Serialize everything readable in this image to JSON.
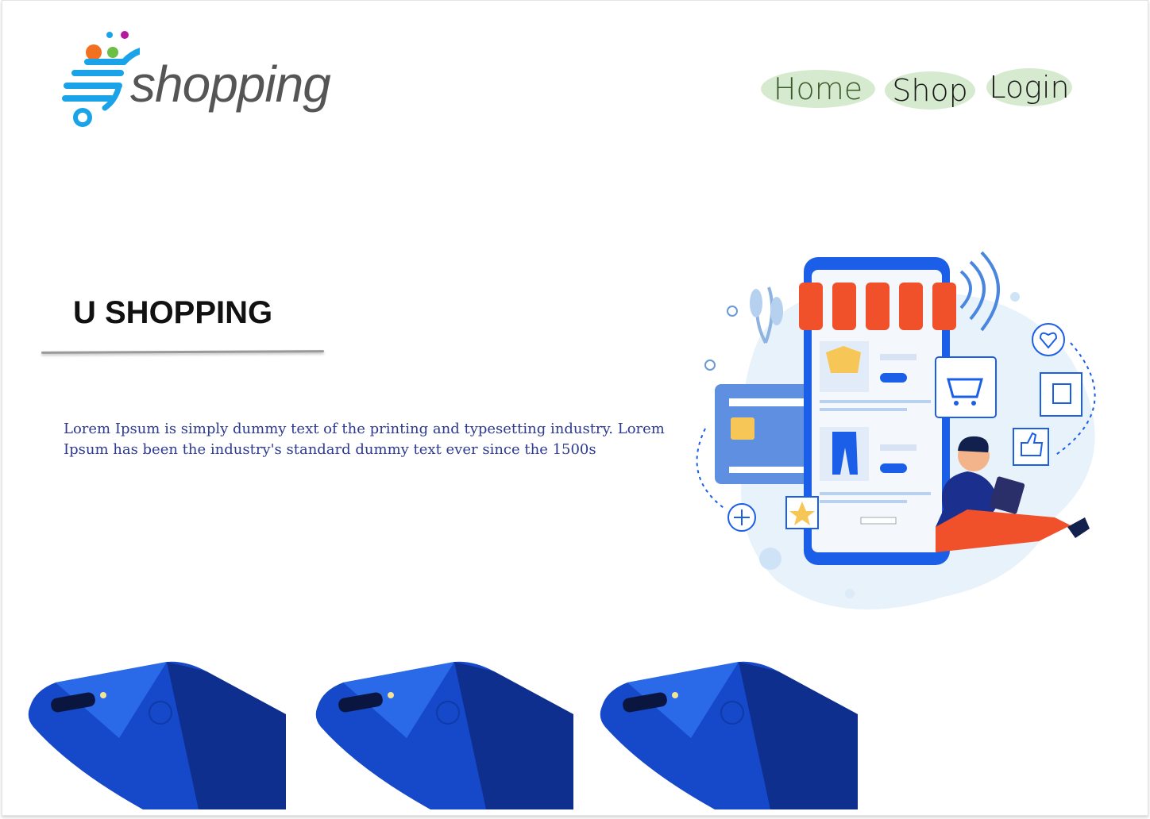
{
  "brand": {
    "logo_text": "shopping"
  },
  "nav": {
    "home": "Home",
    "shop": "Shop",
    "login": "Login"
  },
  "hero": {
    "title": "U SHOPPING",
    "description": "Lorem Ipsum is simply dummy text of the printing and typesetting industry. Lorem Ipsum has been the industry's standard dummy text ever since the 1500s"
  },
  "colors": {
    "accent_blue": "#1aa3e8",
    "nav_pill": "#d6ead0",
    "text_blue": "#2d3a8f",
    "phone_blue": "#1448c8"
  },
  "icons": [
    "cart-logo-icon",
    "shopping-cart-icon",
    "heart-icon",
    "gift-icon",
    "thumbs-up-icon",
    "star-icon",
    "plus-icon"
  ]
}
